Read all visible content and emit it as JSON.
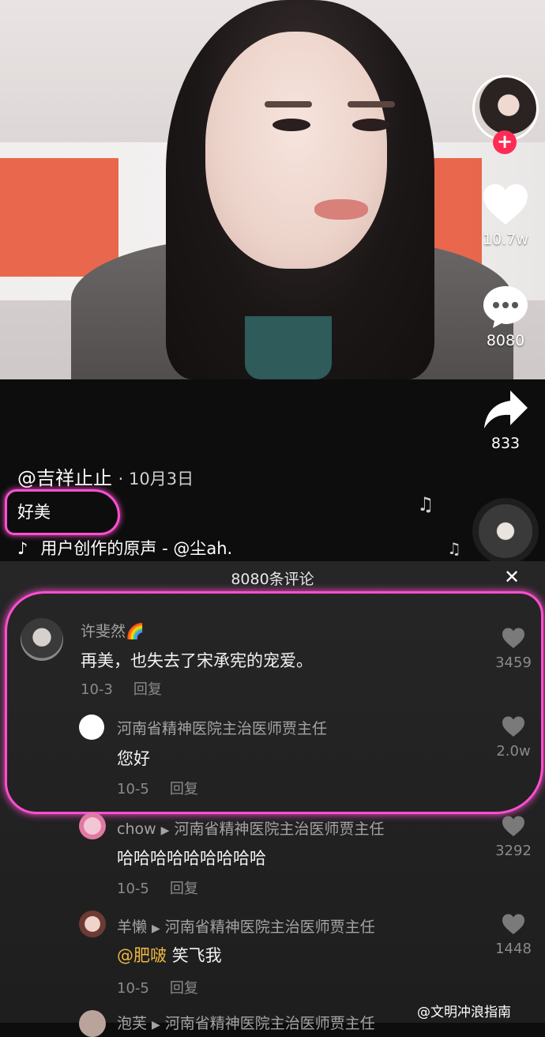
{
  "video": {
    "likes": "10.7w",
    "comments": "8080",
    "shares": "833",
    "author": "@吉祥止止",
    "date": "· 10月3日",
    "description": "好美",
    "music": "用户创作的原声 - @尘ah."
  },
  "comments_panel": {
    "title": "8080条评论",
    "close_glyph": "✕",
    "comments": [
      {
        "name": "许斐然🌈",
        "text": "再美，也失去了宋承宪的宠爱。",
        "date": "10-3",
        "reply": "回复",
        "likes": "3459"
      },
      {
        "name": "河南省精神医院主治医师贾主任",
        "text": "您好",
        "date": "10-5",
        "reply": "回复",
        "likes": "2.0w"
      },
      {
        "name": "chow",
        "reply_to": "河南省精神医院主治医师贾主任",
        "text": "哈哈哈哈哈哈哈哈哈",
        "date": "10-5",
        "reply": "回复",
        "likes": "3292"
      },
      {
        "name": "羊懒",
        "reply_to": "河南省精神医院主治医师贾主任",
        "mention": "@肥啵",
        "text": "笑飞我",
        "date": "10-5",
        "reply": "回复",
        "likes": "1448"
      },
      {
        "name": "泡芙",
        "reply_to": "河南省精神医院主治医师贾主任"
      }
    ]
  },
  "watermark": "@文明冲浪指南",
  "icons": {
    "like": "heart-icon",
    "comment": "comment-bubble-icon",
    "share": "share-arrow-icon",
    "music": "tiktok-note-icon",
    "close": "close-icon",
    "follow": "plus-icon"
  },
  "colors": {
    "accent": "#fe2c55",
    "annotation": "#ff4fd0",
    "mention": "#f1b841"
  }
}
